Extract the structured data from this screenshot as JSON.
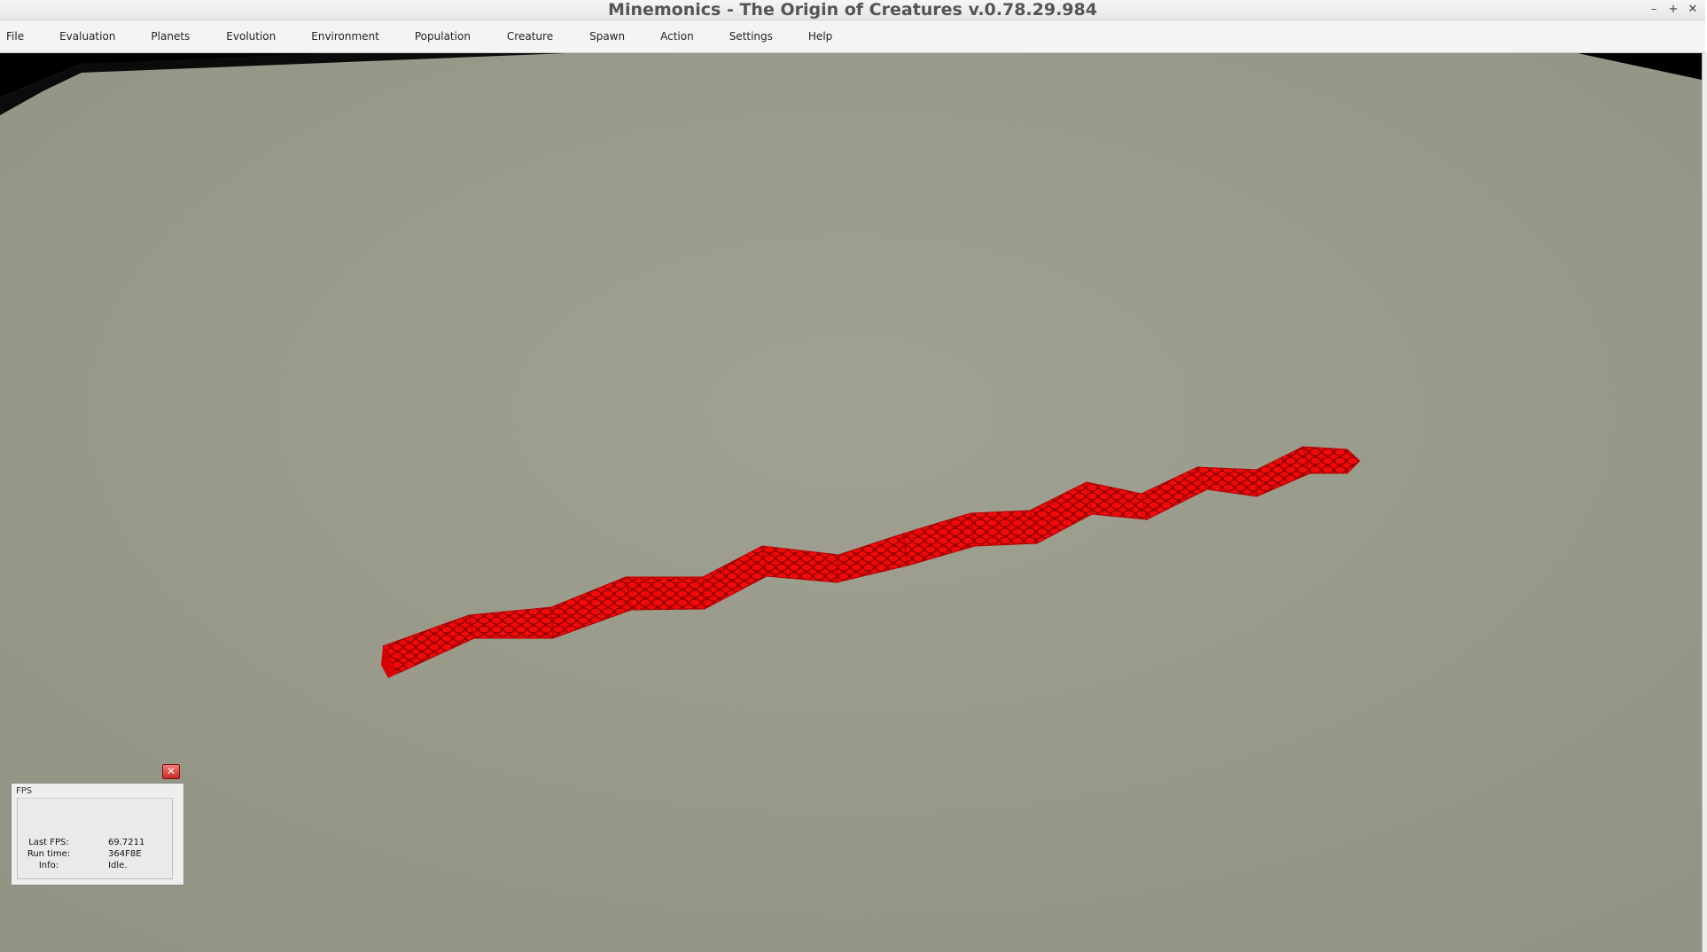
{
  "window": {
    "title": "Minemonics - The Origin of Creatures v.0.78.29.984",
    "controls": {
      "minimize": "–",
      "maximize": "+",
      "close": "✕"
    }
  },
  "menubar": {
    "items": [
      {
        "label": "File"
      },
      {
        "label": "Evaluation"
      },
      {
        "label": "Planets"
      },
      {
        "label": "Evolution"
      },
      {
        "label": "Environment"
      },
      {
        "label": "Population"
      },
      {
        "label": "Creature"
      },
      {
        "label": "Spawn"
      },
      {
        "label": "Action"
      },
      {
        "label": "Settings"
      },
      {
        "label": "Help"
      }
    ]
  },
  "scene": {
    "ground_color": "#9a9b8a",
    "sky_color": "#000000",
    "creature_color": "#e00000",
    "creature_segments": 14
  },
  "fps_panel": {
    "title": "FPS",
    "close_icon": "✕",
    "rows": [
      {
        "label": "Last FPS:",
        "value": "69.7211"
      },
      {
        "label": "Run time:",
        "value": "364F8E"
      },
      {
        "label": "Info:",
        "value": "Idle."
      }
    ]
  }
}
